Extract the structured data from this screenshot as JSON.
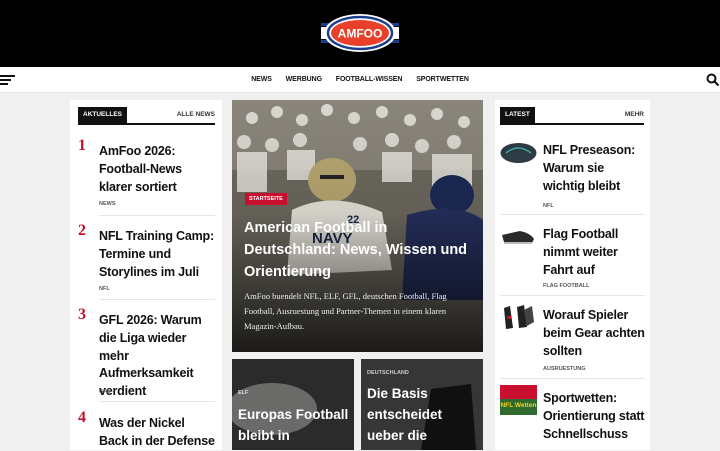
{
  "header": {
    "logo_text": "AMFOO"
  },
  "nav": {
    "items": [
      "NEWS",
      "WERBUNG",
      "FOOTBALL-WISSEN",
      "SPORTWETTEN"
    ]
  },
  "left_panel": {
    "tag": "AKTUELLES",
    "link": "ALLE NEWS",
    "items": [
      {
        "num": "1",
        "title": "AmFoo 2026: Football-News klarer sortiert",
        "cat": "NEWS"
      },
      {
        "num": "2",
        "title": "NFL Training Camp: Termine und Storylines im Juli",
        "cat": "NFL"
      },
      {
        "num": "3",
        "title": "GFL 2026: Warum die Liga wieder mehr Aufmerksamkeit verdient",
        "cat": "GFL"
      },
      {
        "num": "4",
        "title": "Was der Nickel Back in der Defense",
        "cat": ""
      }
    ]
  },
  "feature": {
    "tag": "STARTSEITE",
    "title": "American Football in Deutschland: News, Wissen und Orientierung",
    "excerpt": "AmFoo buendelt NFL, ELF, GFL, deutschen Football, Flag Football, Ausruestung und Partner-Themen in einem klaren Magazin-Aufbau."
  },
  "cards": [
    {
      "tag": "ELF",
      "title": "Europas Football bleibt in Bewegung"
    },
    {
      "tag": "DEUTSCHLAND",
      "title": "Die Basis entscheidet ueber die Zukunft"
    }
  ],
  "right_panel": {
    "tag": "LATEST",
    "link": "MEHR",
    "items": [
      {
        "title": "NFL Preseason: Warum sie wichtig bleibt",
        "cat": "NFL",
        "thumb": "football-thumb"
      },
      {
        "title": "Flag Football nimmt weiter Fahrt auf",
        "cat": "FLAG FOOTBALL",
        "thumb": "cleats-thumb"
      },
      {
        "title": "Worauf Spieler beim Gear achten sollten",
        "cat": "AUSRUESTUNG",
        "thumb": "gloves-thumb"
      },
      {
        "title": "Sportwetten: Orientierung statt Schnellschuss",
        "cat": "",
        "thumb": "nfl-wetten-thumb",
        "thumb_text": "NFL Wetten"
      }
    ]
  },
  "colors": {
    "accent": "#c8102e",
    "topbar": "#000000",
    "logo_blue": "#1c3c8c"
  }
}
